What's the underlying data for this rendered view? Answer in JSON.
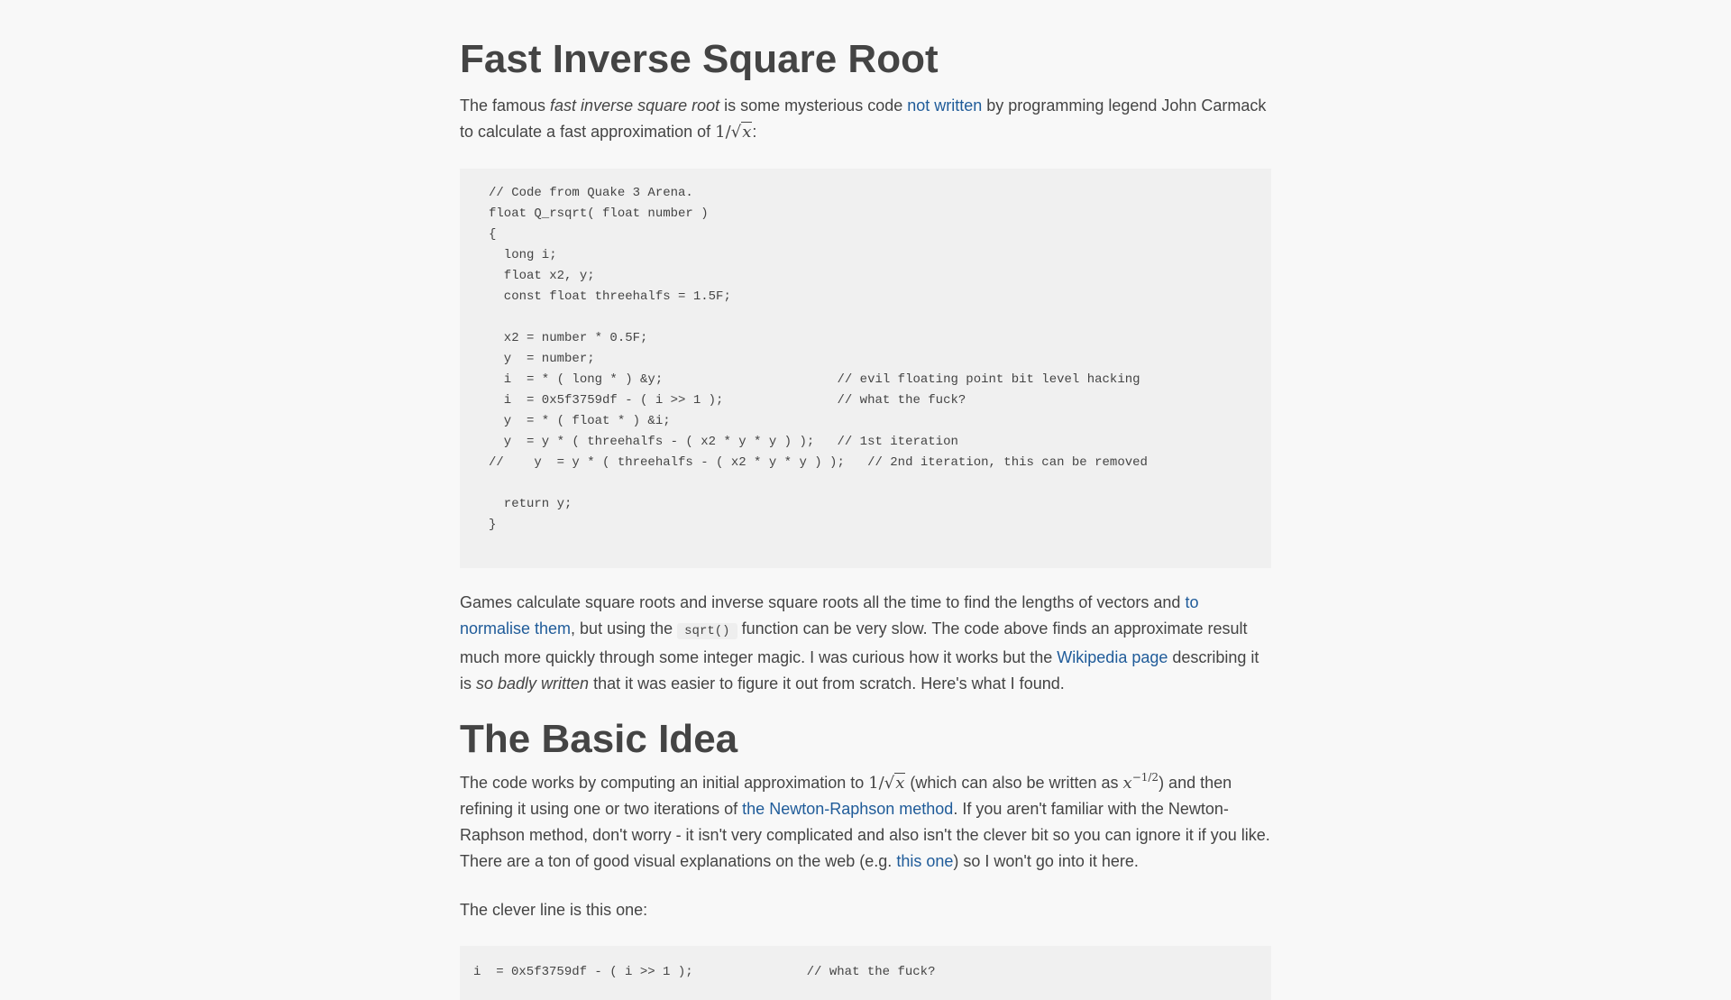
{
  "article": {
    "title": "Fast Inverse Square Root",
    "intro": {
      "t1": "The famous ",
      "em1": "fast inverse square root",
      "t2": " is some mysterious code ",
      "link_not_written": "not written",
      "t3": " by programming legend John Carmack to calculate a fast approximation of ",
      "math_one": "1/",
      "math_x": "x",
      "t4": ":"
    },
    "code_main": "// Code from Quake 3 Arena.\nfloat Q_rsqrt( float number )\n{\n  long i;\n  float x2, y;\n  const float threehalfs = 1.5F;\n\n  x2 = number * 0.5F;\n  y  = number;\n  i  = * ( long * ) &y;                       // evil floating point bit level hacking\n  i  = 0x5f3759df - ( i >> 1 );               // what the fuck?\n  y  = * ( float * ) &i;\n  y  = y * ( threehalfs - ( x2 * y * y ) );   // 1st iteration\n//    y  = y * ( threehalfs - ( x2 * y * y ) );   // 2nd iteration, this can be removed\n\n  return y;\n}",
    "games": {
      "t1": "Games calculate square roots and inverse square roots all the time to find the lengths of vectors and ",
      "link_normalise": "to normalise them",
      "t2": ", but using the ",
      "code_sqrt": "sqrt()",
      "t3": " function can be very slow. The code above finds an approximate result much more quickly through some integer magic. I was curious how it works but the ",
      "link_wikipedia": "Wikipedia page",
      "t4": " describing it is ",
      "em_badly": "so badly written",
      "t5": " that it was easier to figure it out from scratch. Here's what I found."
    },
    "heading_basic_idea": "The Basic Idea",
    "basic": {
      "t1": "The code works by computing an initial approximation to ",
      "math_one": "1/",
      "math_x": "x",
      "t2": " (which can also be written as ",
      "math_base": "x",
      "math_exp": "−1/2",
      "t3": ") and then refining it using one or two iterations of ",
      "link_newton": "the Newton-Raphson method",
      "t4": ". If you aren't familiar with the Newton-Raphson method, don't worry - it isn't very complicated and also isn't the clever bit so you can ignore it if you like. There are a ton of good visual explanations on the web (e.g. ",
      "link_this_one": "this one",
      "t5": ") so I won't go into it here."
    },
    "clever_intro": "The clever line is this one:",
    "code_clever": "i  = 0x5f3759df - ( i >> 1 );               // what the fuck?"
  }
}
